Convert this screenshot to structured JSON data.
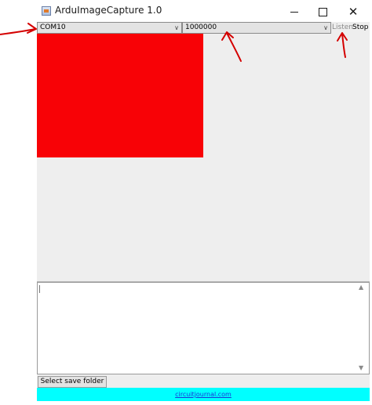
{
  "window": {
    "title": "ArduImageCapture 1.0",
    "icons": {
      "app": "java-app-icon",
      "minimize": "minimize-icon",
      "maximize": "maximize-icon",
      "close": "close-icon"
    }
  },
  "toolbar": {
    "port_value": "COM10",
    "baud_value": "1000000",
    "listen_label": "Listen",
    "stop_label": "Stop"
  },
  "image_panel": {
    "image_color": "#f80206"
  },
  "bottom": {
    "save_folder_label": "Select save folder",
    "footer_link": "circuitjournal.com"
  },
  "annotations": {
    "arrow_color": "#d40000"
  },
  "glyphs": {
    "chevron": "∨",
    "close": "✕",
    "scroll_up": "▲",
    "scroll_down": "▼"
  }
}
